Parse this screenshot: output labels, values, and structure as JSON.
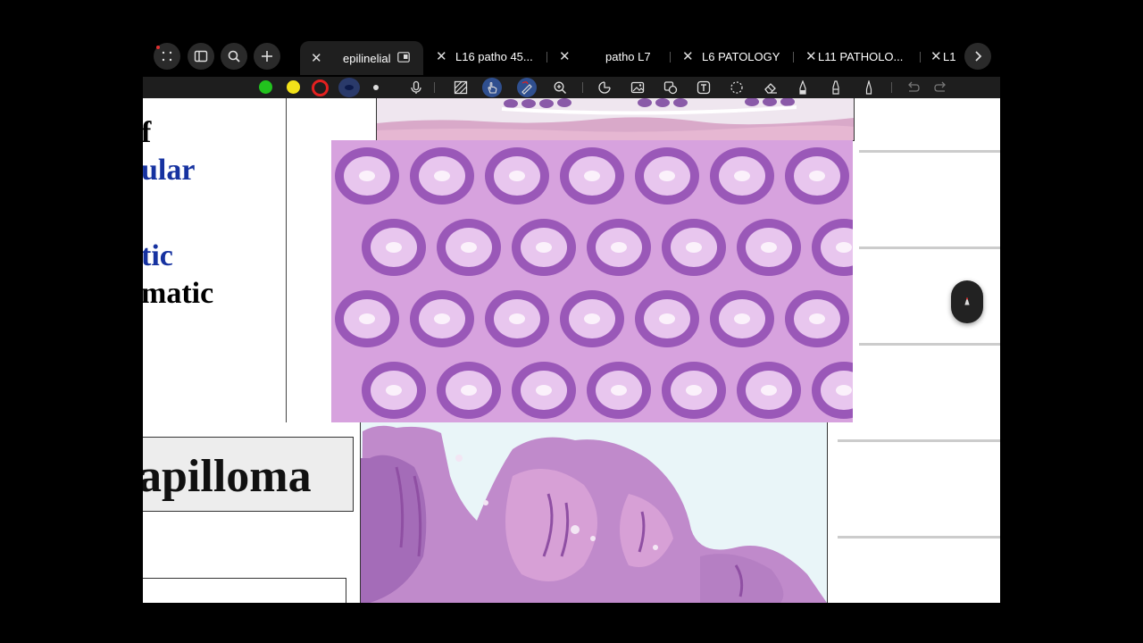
{
  "tabs": [
    {
      "label": "",
      "active": true,
      "title": "epilinelial"
    },
    {
      "label": "L16 patho 45..."
    },
    {
      "label": "patho L7"
    },
    {
      "label": "L6 PATOLOGY"
    },
    {
      "label": "L11 PATHOLO..."
    },
    {
      "label": "L1"
    }
  ],
  "active_tab_title": "epilinelial",
  "colors": {
    "green": "#22c21e",
    "yellow": "#f2e21a",
    "red": "#e3201f",
    "navy": "#1a2a6b",
    "accent": "#2f4f8f",
    "blue_text": "#1632a0"
  },
  "toolbar_icons": [
    "microphone-icon",
    "hatch-icon",
    "touch-icon",
    "lasso-pen-icon",
    "zoom-icon",
    "shape-icon",
    "image-icon",
    "sticker-icon",
    "text-icon",
    "lasso-icon",
    "eraser-icon",
    "pen-icon",
    "highlighter-icon",
    "fine-pen-icon",
    "undo-icon",
    "redo-icon"
  ],
  "slide": {
    "line1": "f",
    "line2": "ular",
    "line3": "tic",
    "line4": "matic",
    "boxed_word": "apilloma"
  }
}
